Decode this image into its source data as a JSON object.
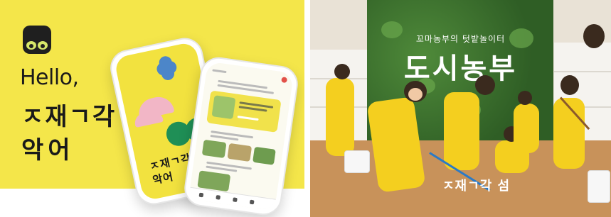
{
  "left": {
    "hello": "Hello,",
    "title_line1": "ㅈ재ㄱ각",
    "title_line2": "악어",
    "phone_back_line1": "ㅈ재ㄱ각",
    "phone_back_line2": "악어",
    "colors": {
      "background": "#f4e64a",
      "accent_green": "#1f8f56",
      "accent_pink": "#f2b6c6",
      "accent_blue": "#4c86c9"
    }
  },
  "right": {
    "subtitle": "꼬마농부의 텃밭놀이터",
    "heading": "도시농부",
    "logo": "ㅈ재ㄱ각 섬",
    "colors": {
      "suit": "#f4cf1f",
      "wall": "#2f5e25",
      "soil": "#c8925a"
    }
  },
  "icons": {
    "app_icon": "frog-eyes-app-icon",
    "notification": "bell-icon"
  }
}
